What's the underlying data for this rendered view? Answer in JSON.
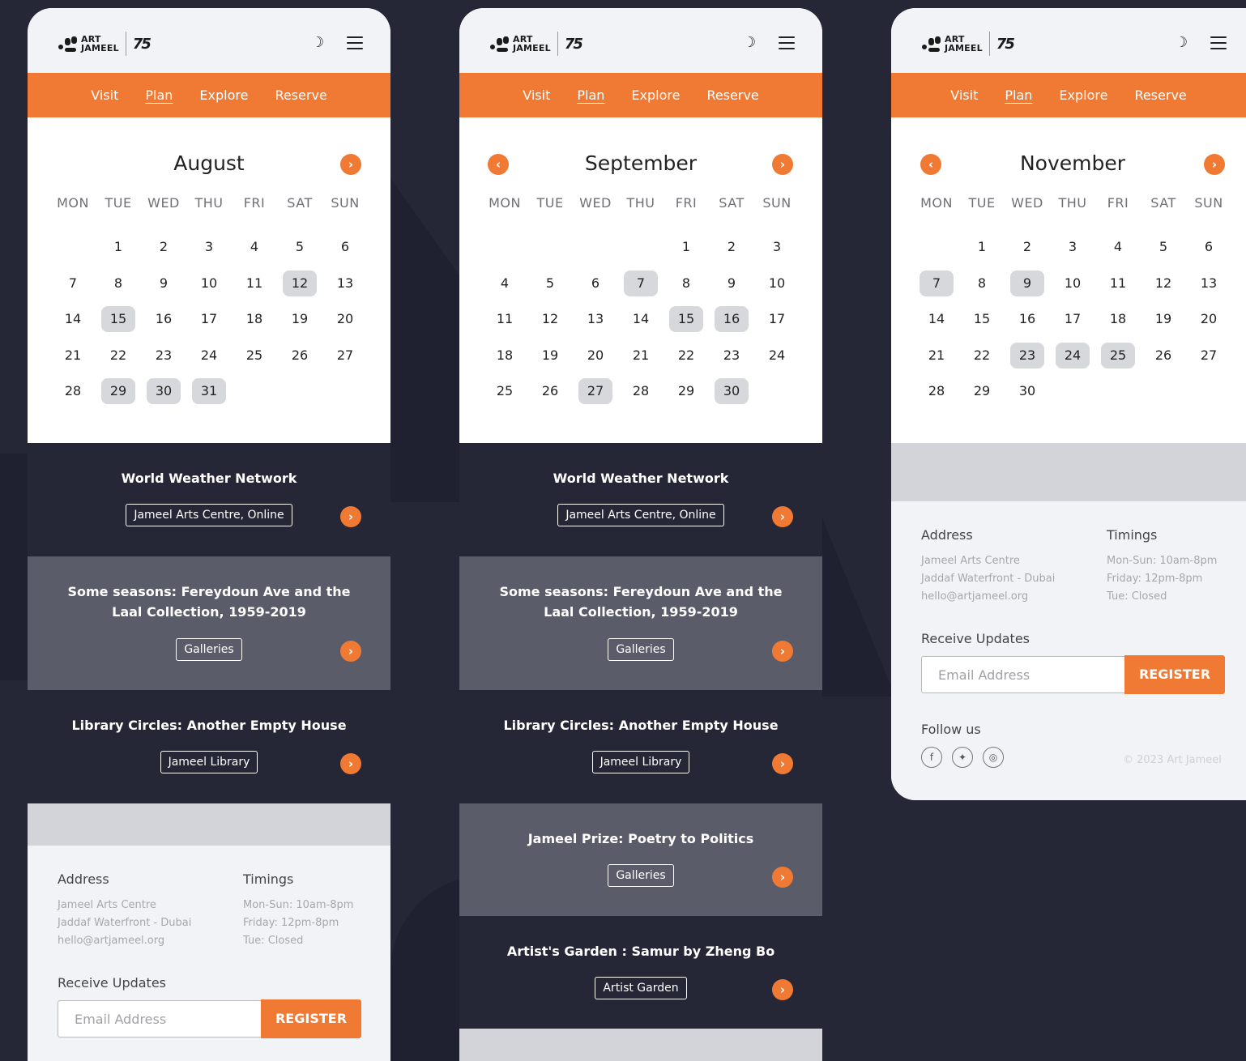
{
  "logo": {
    "art": "ART",
    "jameel": "JAMEEL",
    "seventyfive": "75"
  },
  "nav": [
    "Visit",
    "Plan",
    "Explore",
    "Reserve"
  ],
  "weekdays": [
    "MON",
    "TUE",
    "WED",
    "THU",
    "FRI",
    "SAT",
    "SUN"
  ],
  "screens": [
    {
      "month": "August",
      "offset": 1,
      "count": 31,
      "highlight": [
        12,
        15,
        29,
        30,
        31
      ],
      "prev": false,
      "next": true
    },
    {
      "month": "September",
      "offset": 4,
      "count": 30,
      "highlight": [
        7,
        15,
        16,
        27,
        30
      ],
      "prev": true,
      "next": true
    },
    {
      "month": "November",
      "offset": 1,
      "count": 30,
      "highlight": [
        7,
        9,
        23,
        24,
        25
      ],
      "prev": true,
      "next": true
    }
  ],
  "events": [
    {
      "title": "World Weather Network",
      "tag": "Jameel Arts Centre, Online"
    },
    {
      "title": "Some seasons: Fereydoun Ave and the Laal Collection, 1959-2019",
      "tag": "Galleries"
    },
    {
      "title": "Library Circles: Another Empty House",
      "tag": "Jameel Library"
    },
    {
      "title": "Jameel Prize: Poetry to Politics",
      "tag": "Galleries"
    },
    {
      "title": "Artist's Garden : Samur by Zheng Bo",
      "tag": "Artist Garden"
    }
  ],
  "footer": {
    "address_title": "Address",
    "address_lines": [
      "Jameel Arts Centre",
      "Jaddaf Waterfront - Dubai",
      "hello@artjameel.org"
    ],
    "timings_title": "Timings",
    "timings_lines": [
      "Mon-Sun: 10am-8pm",
      "Friday: 12pm-8pm",
      "Tue: Closed"
    ],
    "updates_title": "Receive Updates",
    "email_placeholder": "Email Address",
    "register_label": "REGISTER",
    "follow_title": "Follow us",
    "copyright": "© 2023 Art Jameel"
  },
  "icons": {
    "prev": "chevron-left-icon",
    "next": "chevron-right-icon",
    "theme": "moon-icon",
    "menu": "hamburger-icon"
  },
  "colors": {
    "accent": "#f07a34",
    "dark": "#252736",
    "mid": "#5b5c6a"
  }
}
